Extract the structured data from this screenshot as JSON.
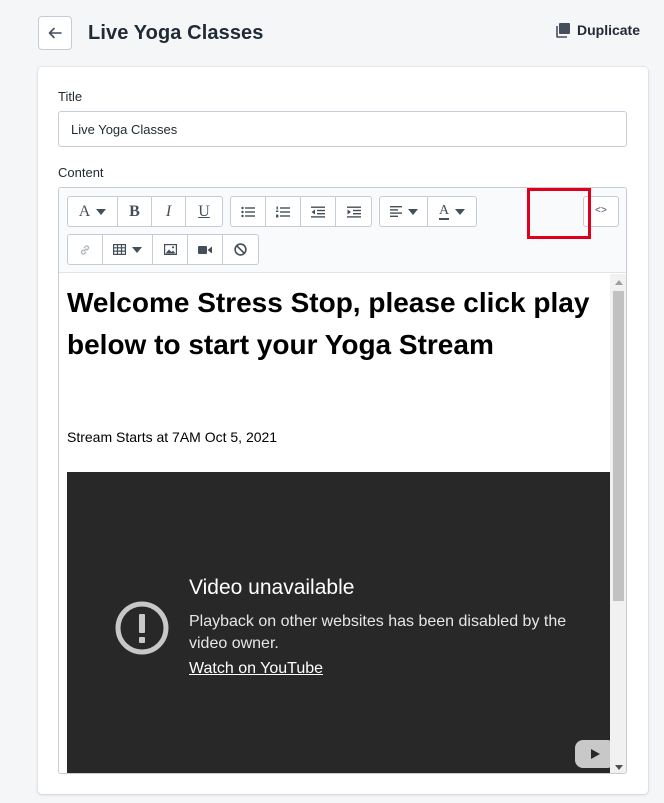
{
  "header": {
    "page_title": "Live Yoga Classes",
    "duplicate_label": "Duplicate"
  },
  "form": {
    "title_label": "Title",
    "title_value": "Live Yoga Classes",
    "content_label": "Content"
  },
  "toolbar": {
    "font_glyph": "A",
    "bold_glyph": "B",
    "italic_glyph": "I",
    "underline_glyph": "U",
    "text_color_glyph": "A",
    "code_label": "<>"
  },
  "content": {
    "heading": "Welcome Stress Stop, please click play below to start your Yoga Stream",
    "stream_text": "Stream Starts at 7AM Oct 5, 2021"
  },
  "video": {
    "title": "Video unavailable",
    "description": "Playback on other websites has been disabled by the video owner.",
    "link": "Watch on YouTube"
  },
  "colors": {
    "highlight": "#e0001b",
    "video_bg": "#282828",
    "page_bg": "#f4f6f8"
  },
  "icons": [
    "back-arrow-icon",
    "duplicate-icon",
    "bullet-list-icon",
    "numbered-list-icon",
    "outdent-icon",
    "indent-icon",
    "align-left-icon",
    "link-icon",
    "table-icon",
    "image-icon",
    "video-icon",
    "clear-format-icon",
    "alert-icon",
    "play-icon"
  ]
}
